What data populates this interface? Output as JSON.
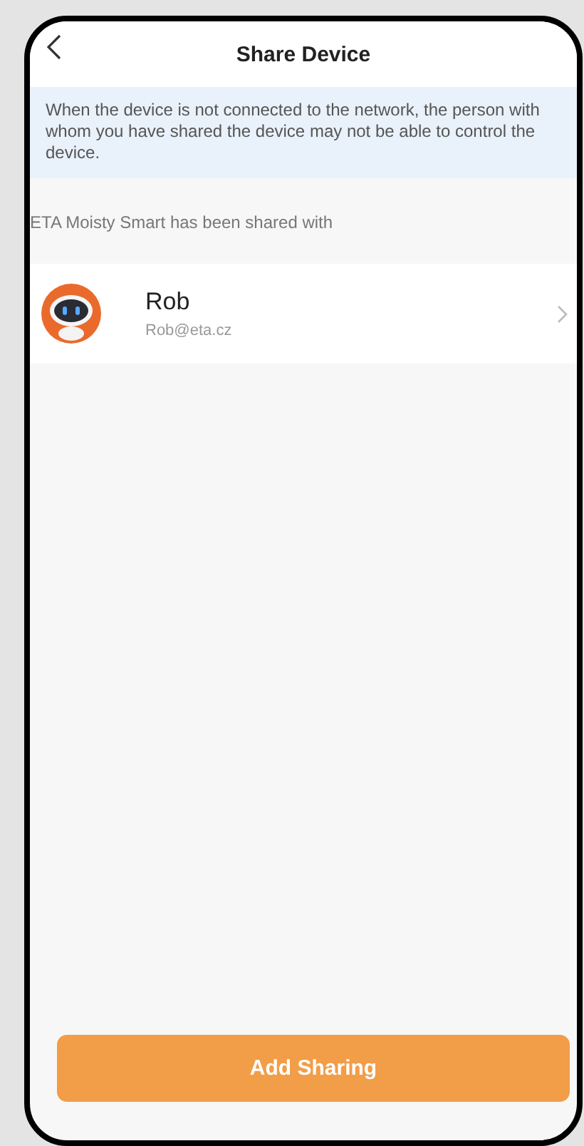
{
  "header": {
    "title": "Share Device"
  },
  "notice": "When the device is not connected to the network, the person with whom you have shared the device may not be able to control the device.",
  "section_label": "ETA Moisty Smart has been shared with",
  "shared_users": [
    {
      "name": "Rob",
      "email": "Rob@eta.cz"
    }
  ],
  "button": "Add Sharing"
}
